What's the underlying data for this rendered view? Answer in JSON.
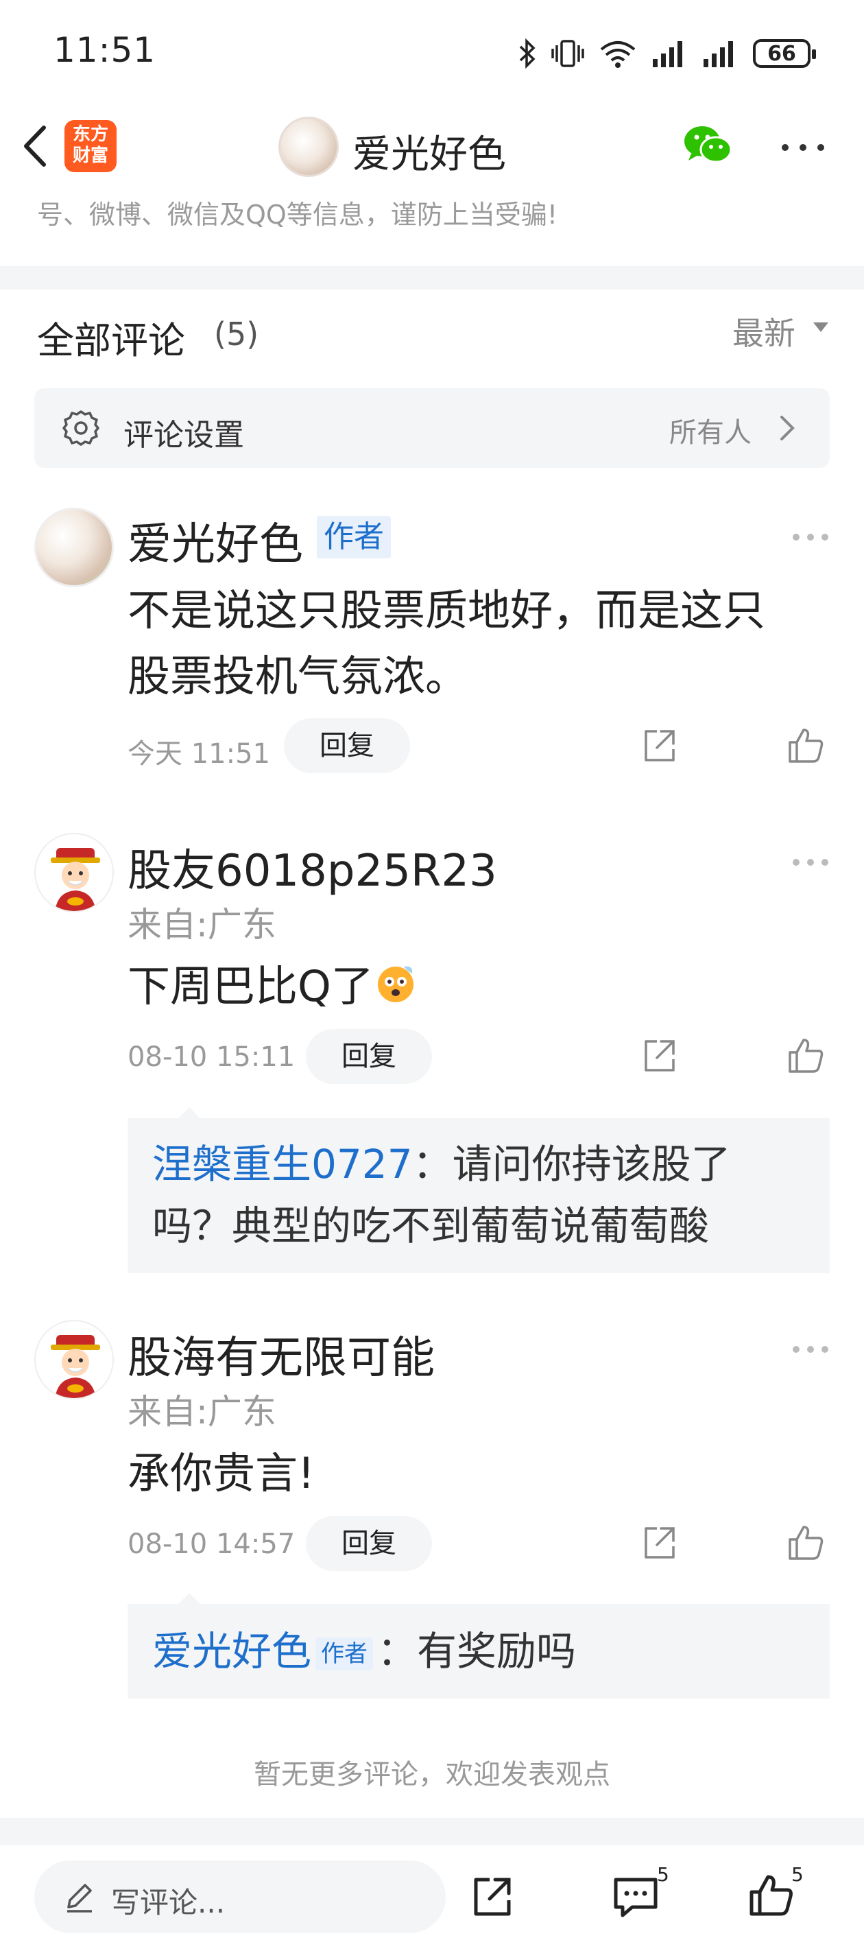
{
  "status_bar": {
    "time": "11:51",
    "battery": "66"
  },
  "nav": {
    "logo_line1": "东方",
    "logo_line2": "财富",
    "title": "爱光好色"
  },
  "notice": "号、微博、微信及QQ等信息，谨防上当受骗!",
  "section": {
    "title": "全部评论",
    "count": "(5)",
    "sort": "最新"
  },
  "settings": {
    "label": "评论设置",
    "value": "所有人"
  },
  "comments": [
    {
      "author": "爱光好色",
      "badge": "作者",
      "region": "",
      "text_line1": "不是说这只股票质地好，而是这只",
      "text_line2": "股票投机气氛浓。",
      "time": "今天 11:51",
      "reply": "回复"
    },
    {
      "author": "股友6018p25R23",
      "region": "来自:广东",
      "text": "下周巴比Q了",
      "time": "08-10 15:11",
      "reply": "回复",
      "sub_reply": {
        "name": "涅槃重生0727",
        "sep": "：",
        "text_line1": "请问你持该股了",
        "text_line2": "吗？典型的吃不到葡萄说葡萄酸"
      }
    },
    {
      "author": "股海有无限可能",
      "region": "来自:广东",
      "text": "承你贵言!",
      "time": "08-10 14:57",
      "reply": "回复",
      "sub_reply": {
        "name": "爱光好色",
        "badge": "作者",
        "sep": "：",
        "text": "有奖励吗"
      }
    }
  ],
  "no_more": "暂无更多评论，欢迎发表观点",
  "bottom_bar": {
    "placeholder": "写评论...",
    "comment_count": "5",
    "like_count": "5"
  },
  "colors": {
    "accent_blue": "#1e6fcc",
    "brand_orange": "#ff5a1f",
    "wechat_green": "#2dc100"
  }
}
